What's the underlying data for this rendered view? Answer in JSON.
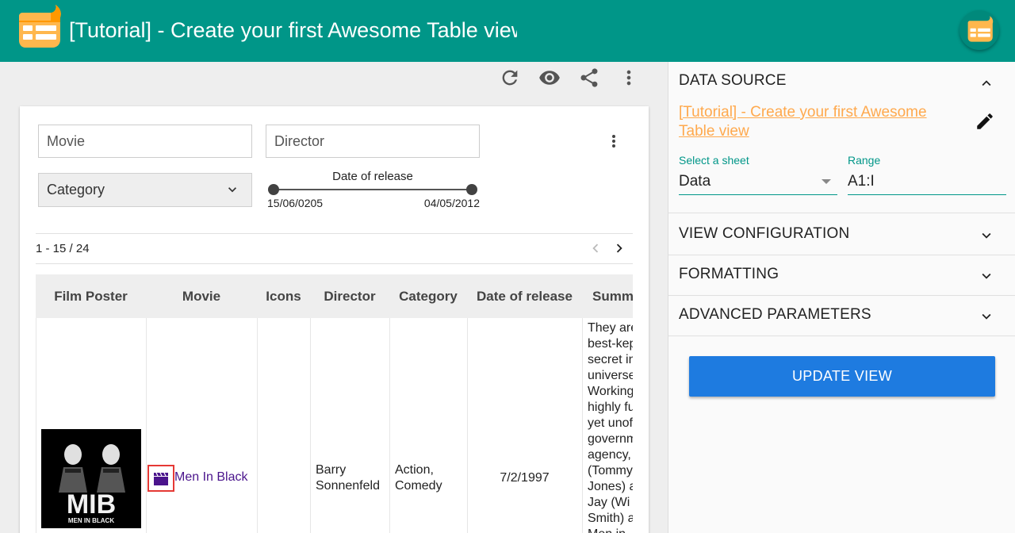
{
  "header": {
    "title": "[Tutorial] - Create your first Awesome Table view"
  },
  "toolbar": {
    "icons": [
      "refresh-icon",
      "eye-icon",
      "share-icon",
      "more-vert-icon"
    ]
  },
  "filters": {
    "movie_placeholder": "Movie",
    "director_placeholder": "Director",
    "category_label": "Category",
    "date_slider": {
      "label": "Date of release",
      "min": "15/06/0205",
      "max": "04/05/2012"
    }
  },
  "pagination": {
    "text": "1 - 15 / 24"
  },
  "table": {
    "columns": [
      "Film Poster",
      "Movie",
      "Icons",
      "Director",
      "Category",
      "Date of release",
      "Summary"
    ],
    "row": {
      "poster_text": "MIB",
      "poster_subtext": "MEN IN BLACK",
      "movie": "Men In Black",
      "director_line1": "Barry",
      "director_line2": "Sonnenfeld",
      "category_line1": "Action,",
      "category_line2": "Comedy",
      "date": "7/2/1997",
      "summary_lines": [
        "They are",
        "best-kept",
        "secret in",
        "universe.",
        "Working",
        "highly fu",
        "yet unof",
        "governm",
        "agency,",
        "(Tommy",
        "Jones) a",
        "Jay (Wi",
        "Smith) a",
        "Men in"
      ]
    }
  },
  "panel": {
    "data_source": {
      "title": "DATA SOURCE",
      "link": "[Tutorial] - Create your first Awesome Table view",
      "sheet_label": "Select a sheet",
      "sheet_value": "Data",
      "range_label": "Range",
      "range_value": "A1:I"
    },
    "sections": {
      "view_configuration": "VIEW CONFIGURATION",
      "formatting": "FORMATTING",
      "advanced_parameters": "ADVANCED PARAMETERS"
    },
    "update_button": "UPDATE VIEW"
  },
  "colors": {
    "header": "#009688",
    "accent": "#009688",
    "link": "#ffa94d",
    "button": "#1e7be0",
    "movie_link": "#4a148c"
  }
}
